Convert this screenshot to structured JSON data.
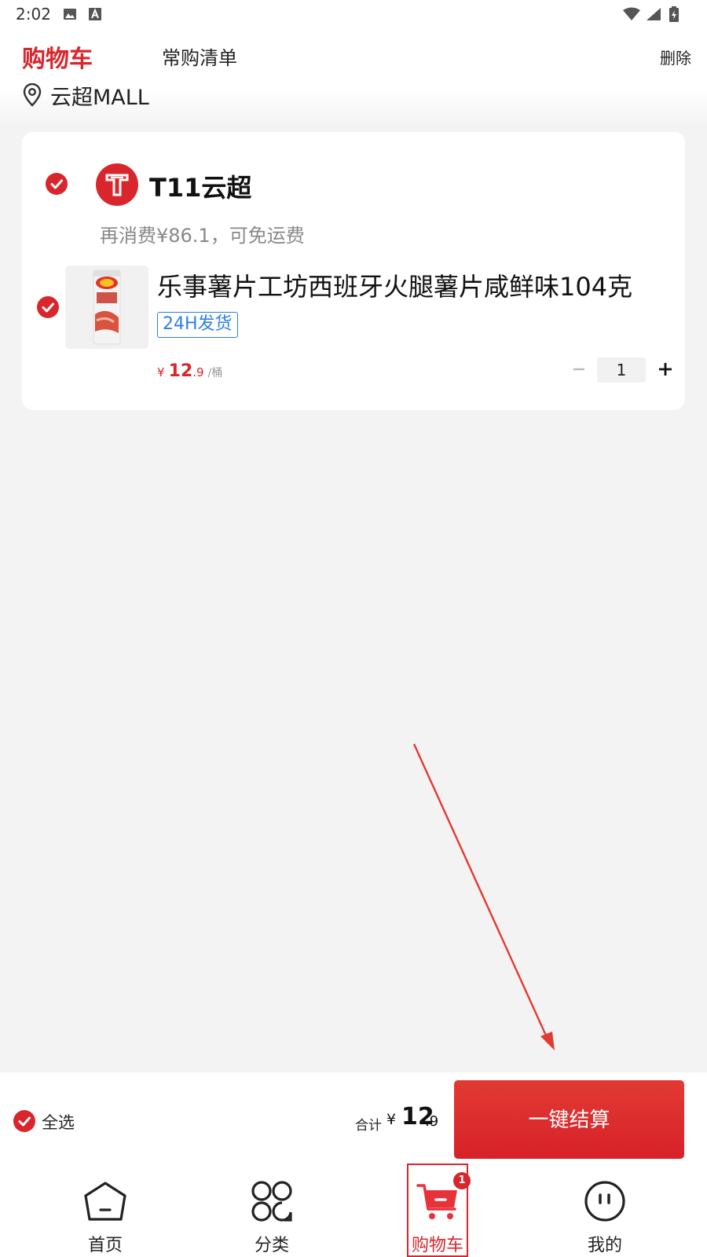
{
  "status_bar": {
    "time": "2:02",
    "left_icons": [
      "image-icon",
      "text-a-icon"
    ],
    "right_icons": [
      "wifi-icon",
      "signal-icon",
      "battery-charging-icon"
    ]
  },
  "header": {
    "tabs": [
      {
        "label": "购物车",
        "active": true
      },
      {
        "label": "常购清单",
        "active": false
      }
    ],
    "delete_label": "删除",
    "location": "云超MALL"
  },
  "store": {
    "name": "T11云超",
    "selected": true,
    "shipping_tip": "再消费¥86.1，可免运费",
    "items": [
      {
        "title": "乐事薯片工坊西班牙火腿薯片咸鲜味104克",
        "tag": "24H发货",
        "price_currency": "¥",
        "price_int": "12",
        "price_dec": ".9",
        "unit": "/桶",
        "quantity": "1",
        "selected": true
      }
    ]
  },
  "checkout": {
    "select_all_label": "全选",
    "total_label": "合计",
    "total_currency": "¥",
    "total_int": "12",
    "total_dec": ".9",
    "button_label": "一键结算"
  },
  "bottom_nav": {
    "items": [
      {
        "label": "首页",
        "icon": "home-icon"
      },
      {
        "label": "分类",
        "icon": "category-icon"
      },
      {
        "label": "购物车",
        "icon": "cart-icon",
        "active": true,
        "badge": "1"
      },
      {
        "label": "我的",
        "icon": "profile-icon"
      }
    ]
  },
  "colors": {
    "accent": "#d9262c",
    "tag_blue": "#2d7fe8",
    "background": "#f3f3f3"
  }
}
